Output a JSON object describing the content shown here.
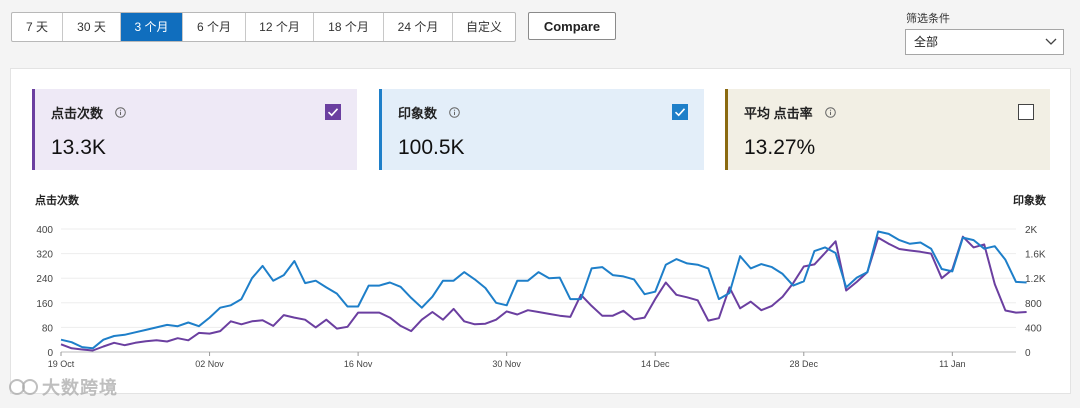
{
  "ranges": [
    "7 天",
    "30 天",
    "3 个月",
    "6 个月",
    "12 个月",
    "18 个月",
    "24 个月",
    "自定义"
  ],
  "active_range": "3 个月",
  "compare_label": "Compare",
  "filter": {
    "label": "筛选条件",
    "value": "全部"
  },
  "cards": [
    {
      "title": "点击次数",
      "value": "13.3K",
      "checked": true,
      "color": "#6b3fa0"
    },
    {
      "title": "印象数",
      "value": "100.5K",
      "checked": true,
      "color": "#1e7fc9"
    },
    {
      "title": "平均 点击率",
      "value": "13.27%",
      "checked": false,
      "color": "#8a6a10"
    }
  ],
  "watermark": "大数跨境",
  "chart_data": {
    "type": "line",
    "x": [
      "19 Oct",
      "20 Oct",
      "21 Oct",
      "22 Oct",
      "23 Oct",
      "24 Oct",
      "25 Oct",
      "26 Oct",
      "27 Oct",
      "28 Oct",
      "29 Oct",
      "30 Oct",
      "31 Oct",
      "01 Nov",
      "02 Nov",
      "03 Nov",
      "04 Nov",
      "05 Nov",
      "06 Nov",
      "07 Nov",
      "08 Nov",
      "09 Nov",
      "10 Nov",
      "11 Nov",
      "12 Nov",
      "13 Nov",
      "14 Nov",
      "15 Nov",
      "16 Nov",
      "17 Nov",
      "18 Nov",
      "19 Nov",
      "20 Nov",
      "21 Nov",
      "22 Nov",
      "23 Nov",
      "24 Nov",
      "25 Nov",
      "26 Nov",
      "27 Nov",
      "28 Nov",
      "29 Nov",
      "30 Nov",
      "01 Dec",
      "02 Dec",
      "03 Dec",
      "04 Dec",
      "05 Dec",
      "06 Dec",
      "07 Dec",
      "08 Dec",
      "09 Dec",
      "10 Dec",
      "11 Dec",
      "12 Dec",
      "13 Dec",
      "14 Dec",
      "15 Dec",
      "16 Dec",
      "17 Dec",
      "18 Dec",
      "19 Dec",
      "20 Dec",
      "21 Dec",
      "22 Dec",
      "23 Dec",
      "24 Dec",
      "25 Dec",
      "26 Dec",
      "27 Dec",
      "28 Dec",
      "29 Dec",
      "30 Dec",
      "31 Dec",
      "01 Jan",
      "02 Jan",
      "03 Jan",
      "04 Jan",
      "05 Jan",
      "06 Jan",
      "07 Jan",
      "08 Jan",
      "09 Jan",
      "10 Jan",
      "11 Jan",
      "12 Jan",
      "13 Jan",
      "14 Jan",
      "15 Jan",
      "16 Jan",
      "17 Jan"
    ],
    "x_ticks": [
      "19 Oct",
      "02 Nov",
      "16 Nov",
      "30 Nov",
      "14 Dec",
      "28 Dec",
      "11 Jan"
    ],
    "left_axis": {
      "label": "点击次数",
      "ticks": [
        "0",
        "80",
        "160",
        "240",
        "320",
        "400"
      ],
      "range": [
        0,
        400
      ]
    },
    "right_axis": {
      "label": "印象数",
      "ticks": [
        "0",
        "400",
        "800",
        "1.2K",
        "1.6K",
        "2K"
      ],
      "range": [
        0,
        2000
      ]
    },
    "series": [
      {
        "name": "点击次数",
        "axis": "left",
        "color": "#6b3fa0",
        "values": [
          25,
          12,
          8,
          5,
          18,
          30,
          22,
          30,
          35,
          38,
          34,
          45,
          38,
          62,
          60,
          68,
          100,
          90,
          100,
          103,
          85,
          120,
          112,
          105,
          80,
          105,
          76,
          82,
          128,
          128,
          128,
          112,
          85,
          68,
          105,
          130,
          105,
          140,
          100,
          90,
          92,
          105,
          132,
          122,
          136,
          130,
          124,
          118,
          114,
          186,
          150,
          118,
          118,
          134,
          106,
          112,
          172,
          226,
          186,
          178,
          168,
          102,
          110,
          210,
          142,
          164,
          136,
          150,
          180,
          224,
          278,
          285,
          322,
          360,
          200,
          228,
          260,
          372,
          352,
          335,
          330,
          326,
          320,
          240,
          268,
          375,
          340,
          350,
          220,
          135,
          128,
          130
        ]
      },
      {
        "name": "印象数",
        "axis": "right",
        "color": "#1e7fc9",
        "values": [
          200,
          160,
          80,
          60,
          200,
          260,
          280,
          320,
          360,
          400,
          440,
          420,
          480,
          420,
          560,
          720,
          760,
          860,
          1200,
          1400,
          1160,
          1250,
          1480,
          1120,
          1160,
          1050,
          950,
          740,
          740,
          1080,
          1080,
          1130,
          1060,
          880,
          720,
          900,
          1160,
          1160,
          1300,
          1180,
          1040,
          800,
          760,
          1160,
          1160,
          1300,
          1200,
          1210,
          860,
          860,
          1360,
          1380,
          1250,
          1230,
          1180,
          940,
          980,
          1420,
          1510,
          1440,
          1420,
          1360,
          860,
          960,
          1560,
          1360,
          1430,
          1380,
          1270,
          1080,
          1150,
          1640,
          1700,
          1610,
          1050,
          1210,
          1300,
          1960,
          1920,
          1820,
          1760,
          1780,
          1680,
          1350,
          1310,
          1860,
          1820,
          1680,
          1720,
          1500,
          1140,
          1130
        ]
      }
    ]
  }
}
